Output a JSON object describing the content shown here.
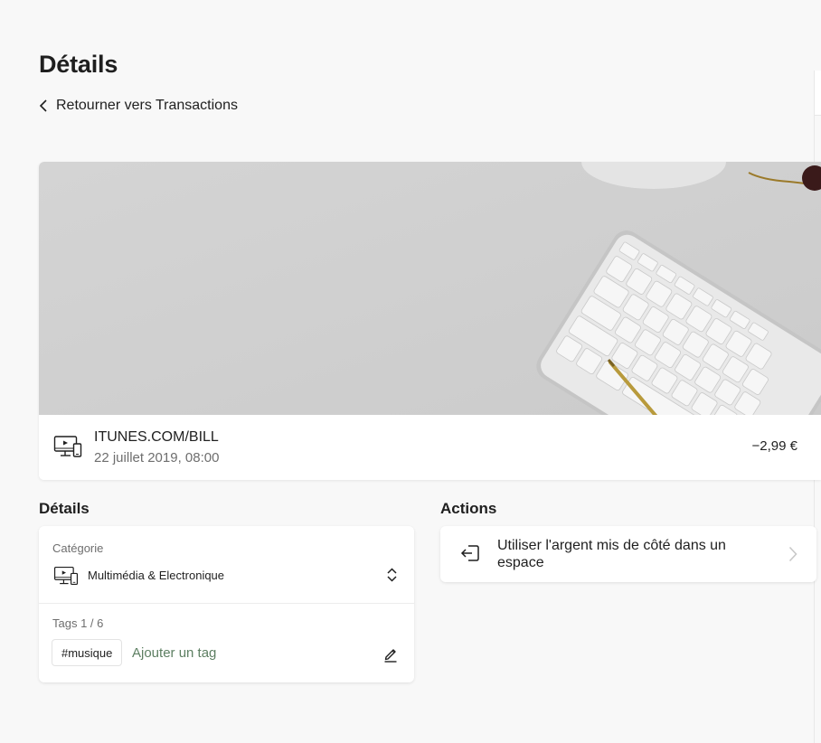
{
  "page": {
    "title": "Détails",
    "back_label": "Retourner vers Transactions"
  },
  "transaction": {
    "merchant": "ITUNES.COM/BILL",
    "date": "22 juillet 2019, 08:00",
    "amount": "−2,99 €",
    "icon": "multimedia-devices-icon",
    "image": "desk-keyboard-photo"
  },
  "details": {
    "section_title": "Détails",
    "category_label": "Catégorie",
    "category_value": "Multimédia & Electronique",
    "category_icon": "multimedia-devices-icon",
    "tags_label": "Tags 1 / 6",
    "tags": [
      "#musique"
    ],
    "add_tag_label": "Ajouter un tag"
  },
  "actions": {
    "section_title": "Actions",
    "items": [
      {
        "label": "Utiliser l'argent mis de côté dans un espace",
        "icon": "enter-space-icon"
      }
    ]
  },
  "colors": {
    "background": "#f8f8f8",
    "card": "#ffffff",
    "text": "#1f1f1f",
    "muted": "#6e6e6e",
    "accent_green": "#5d7f62"
  }
}
